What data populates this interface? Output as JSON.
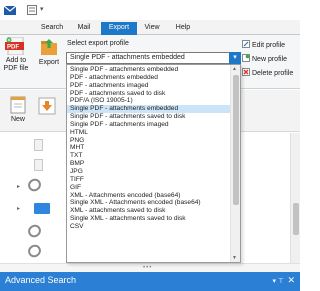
{
  "tabs": [
    "Search",
    "Mail",
    "Export",
    "View",
    "Help"
  ],
  "active_tab": "Export",
  "ribbon": {
    "add_to_pdf_label": [
      "Add to",
      "PDF file"
    ],
    "export_label": "Export",
    "profile_label": "Select export profile",
    "selected_profile": "Single PDF - attachments embedded",
    "edit_profile": "Edit profile",
    "new_profile": "New profile",
    "delete_profile": "Delete profile",
    "new_label": "New"
  },
  "profiles": [
    "Single PDF - attachments embedded",
    "PDF - attachments embedded",
    "PDF - attachments imaged",
    "PDF - attachments saved to disk",
    "PDF/A (ISO 19005-1)",
    "Single PDF - attachments embedded",
    "Single PDF - attachments saved to disk",
    "Single PDF - attachments imaged",
    "HTML",
    "PNG",
    "MHT",
    "TXT",
    "BMP",
    "JPG",
    "TIFF",
    "GIF",
    "XML - Attachments encoded (base64)",
    "Single XML - Attachments encoded (base64)",
    "XML - attachments saved to disk",
    "Single XML - attachments saved to disk",
    "CSV"
  ],
  "highlighted_index": 5,
  "advanced_search": {
    "label": "Advanced Search",
    "pin": "▾ ⊤",
    "close": "✕"
  },
  "colors": {
    "accent": "#1e78c8",
    "selection": "#cce4f7",
    "search_bar": "#2b7fd4"
  }
}
